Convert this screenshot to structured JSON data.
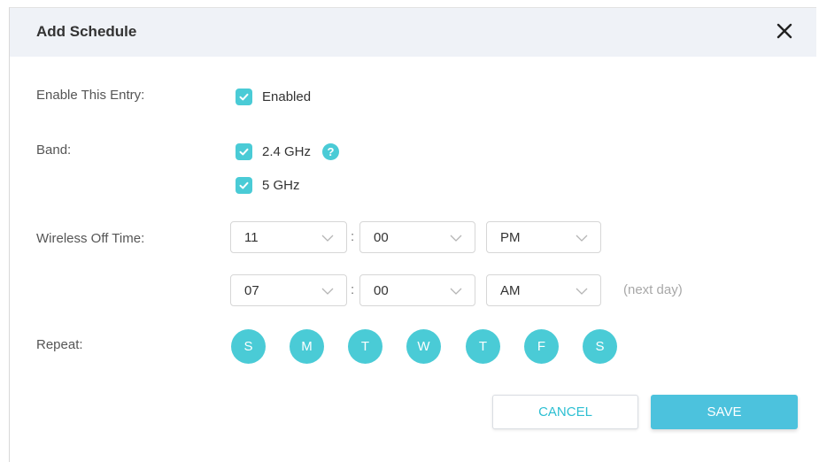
{
  "dialog": {
    "title": "Add Schedule",
    "close_icon": "close-icon"
  },
  "enable_entry": {
    "label": "Enable This Entry:",
    "checkbox_label": "Enabled",
    "checked": true
  },
  "band": {
    "label": "Band:",
    "options": [
      {
        "label": "2.4 GHz",
        "checked": true
      },
      {
        "label": "5 GHz",
        "checked": true
      }
    ],
    "help_icon": "help-icon",
    "help_glyph": "?"
  },
  "wireless_off_time": {
    "label": "Wireless Off Time:",
    "separator": ":",
    "start": {
      "hour": "11",
      "minute": "00",
      "ampm": "PM"
    },
    "end": {
      "hour": "07",
      "minute": "00",
      "ampm": "AM"
    },
    "end_note": "(next day)"
  },
  "repeat": {
    "label": "Repeat:",
    "days": [
      "S",
      "M",
      "T",
      "W",
      "T",
      "F",
      "S"
    ]
  },
  "buttons": {
    "cancel": "CANCEL",
    "save": "SAVE"
  },
  "colors": {
    "accent": "#4acbd6",
    "save_button": "#4cc2dd",
    "header_bg": "#eff2f7"
  }
}
